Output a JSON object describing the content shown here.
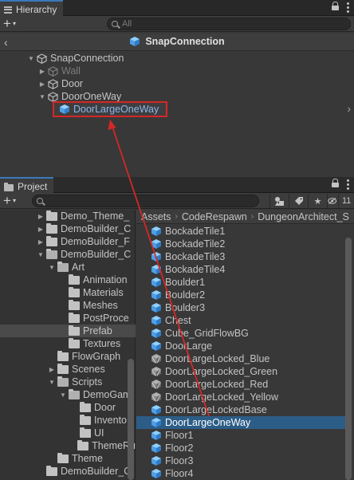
{
  "hierarchy": {
    "tab_label": "Hierarchy",
    "search_placeholder": "All",
    "scene_title": "SnapConnection",
    "rows": [
      {
        "label": "SnapConnection",
        "state": "normal"
      },
      {
        "label": "Wall",
        "state": "disabled"
      },
      {
        "label": "Door",
        "state": "normal"
      },
      {
        "label": "DoorOneWay",
        "state": "normal"
      },
      {
        "label": "DoorLargeOneWay",
        "state": "selected"
      }
    ]
  },
  "project": {
    "tab_label": "Project",
    "hidden_count": "11",
    "breadcrumb": [
      "Assets",
      "CodeRespawn",
      "DungeonArchitect_S"
    ],
    "folders": [
      {
        "label": "Demo_Theme_"
      },
      {
        "label": "DemoBuilder_C"
      },
      {
        "label": "DemoBuilder_F"
      },
      {
        "label": "DemoBuilder_C"
      },
      {
        "label": "Art"
      },
      {
        "label": "Animation"
      },
      {
        "label": "Materials"
      },
      {
        "label": "Meshes"
      },
      {
        "label": "PostProce"
      },
      {
        "label": "Prefab"
      },
      {
        "label": "Textures"
      },
      {
        "label": "FlowGraph"
      },
      {
        "label": "Scenes"
      },
      {
        "label": "Scripts"
      },
      {
        "label": "DemoGam"
      },
      {
        "label": "Door"
      },
      {
        "label": "Invento"
      },
      {
        "label": "UI"
      },
      {
        "label": "ThemeRu"
      },
      {
        "label": "Theme"
      },
      {
        "label": "DemoBuilder_C"
      }
    ],
    "files": [
      {
        "label": "BockadeTile1"
      },
      {
        "label": "BockadeTile2"
      },
      {
        "label": "BockadeTile3"
      },
      {
        "label": "BockadeTile4"
      },
      {
        "label": "Boulder1"
      },
      {
        "label": "Boulder2"
      },
      {
        "label": "Boulder3"
      },
      {
        "label": "Chest"
      },
      {
        "label": "Cube_GridFlowBG"
      },
      {
        "label": "DoorLarge"
      },
      {
        "label": "DoorLargeLocked_Blue"
      },
      {
        "label": "DoorLargeLocked_Green"
      },
      {
        "label": "DoorLargeLocked_Red"
      },
      {
        "label": "DoorLargeLocked_Yellow"
      },
      {
        "label": "DoorLargeLockedBase"
      },
      {
        "label": "DoorLargeOneWay"
      },
      {
        "label": "Floor1"
      },
      {
        "label": "Floor2"
      },
      {
        "label": "Floor3"
      },
      {
        "label": "Floor4"
      }
    ]
  },
  "colors": {
    "accent": "#3a79bb",
    "selection": "#2c5d87",
    "annotation_red": "#d62727",
    "prefab_blue": "#5aa3e8"
  }
}
